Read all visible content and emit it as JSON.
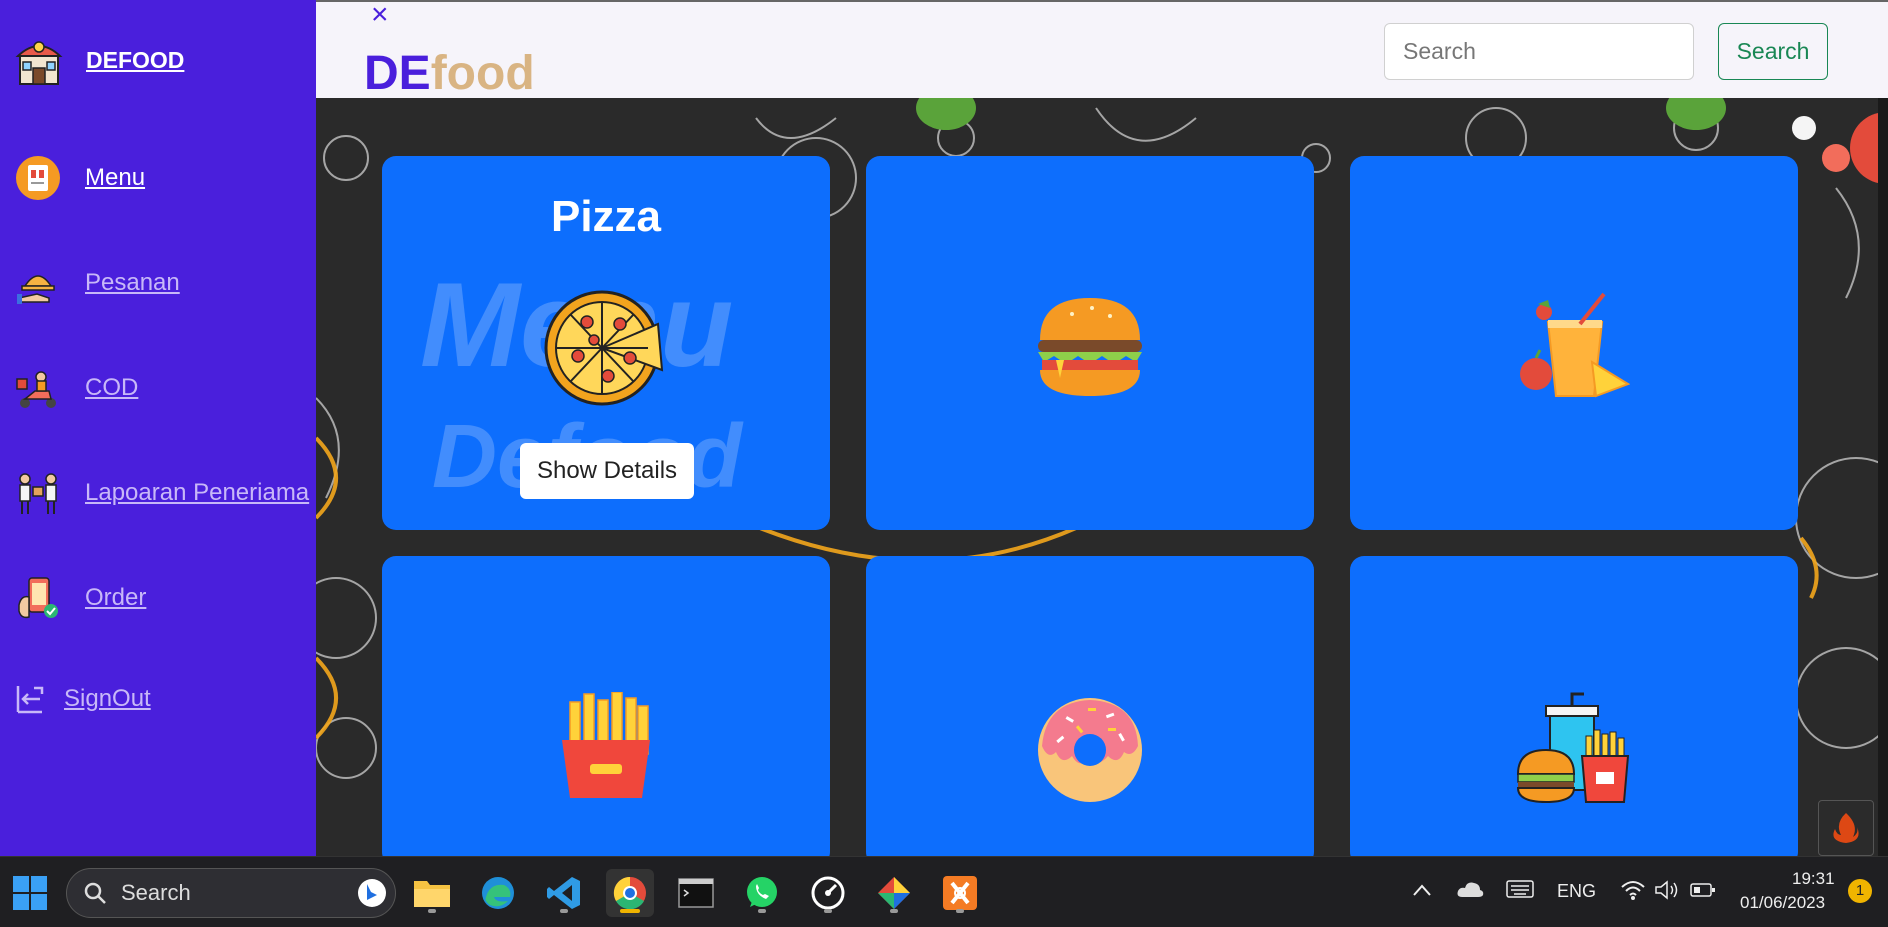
{
  "sidebar": {
    "brand": "DEFOOD",
    "items": [
      {
        "label": "Menu"
      },
      {
        "label": "Pesanan"
      },
      {
        "label": "COD"
      },
      {
        "label": "Lapoaran Peneriama"
      },
      {
        "label": "Order"
      }
    ],
    "signout": "SignOut"
  },
  "header": {
    "close_glyph": "×",
    "logo_de": "DE",
    "logo_food": "food",
    "search_placeholder": "Search",
    "search_button": "Search"
  },
  "cards": [
    {
      "title": "Pizza",
      "watermark_1": "Menu",
      "watermark_2": "Defood",
      "button": "Show Details",
      "icon": "pizza-icon"
    },
    {
      "icon": "burger-icon"
    },
    {
      "icon": "juice-icon"
    },
    {
      "icon": "fries-icon"
    },
    {
      "icon": "donut-icon"
    },
    {
      "icon": "fastfood-combo-icon"
    }
  ],
  "taskbar": {
    "search": "Search",
    "language": "ENG",
    "time": "19:31",
    "date": "01/06/2023",
    "notification_count": "1"
  }
}
